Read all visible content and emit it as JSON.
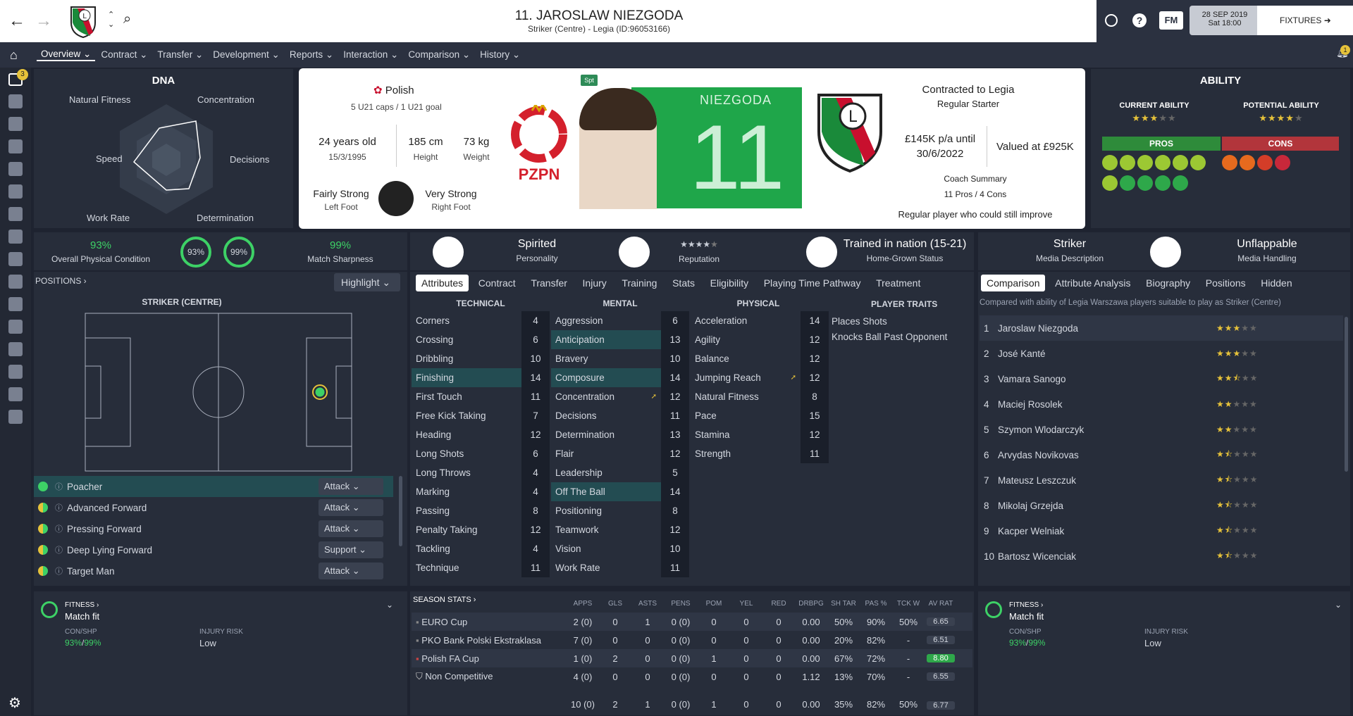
{
  "header": {
    "title": "11. JAROSLAW NIEZGODA",
    "subtitle": "Striker (Centre) - Legia (ID:96053166)",
    "date": "28 SEP 2019",
    "time": "Sat 18:00",
    "fixtures": "FIXTURES",
    "fm": "FM",
    "help": "?",
    "notif_count": "1"
  },
  "nav": {
    "tabs": [
      "Overview",
      "Contract",
      "Transfer",
      "Development",
      "Reports",
      "Interaction",
      "Comparison",
      "History"
    ],
    "inbox_count": "3"
  },
  "dna": {
    "title": "DNA",
    "labels": [
      "Natural Fitness",
      "Concentration",
      "Speed",
      "Decisions",
      "Work Rate",
      "Determination"
    ]
  },
  "profile": {
    "nation": "Polish",
    "caps": "5 U21 caps / 1 U21 goal",
    "age": "24 years old",
    "dob": "15/3/1995",
    "height": "185 cm",
    "height_l": "Height",
    "weight": "73 kg",
    "weight_l": "Weight",
    "left_foot": "Fairly Strong",
    "left_foot_l": "Left Foot",
    "right_foot": "Very Strong",
    "right_foot_l": "Right Foot",
    "spt": "Spt",
    "pzpn": "PZPN",
    "shirt_name": "NIEZGODA",
    "shirt_number": "11",
    "contracted": "Contracted to Legia",
    "status": "Regular Starter",
    "wage": "£145K p/a until",
    "until": "30/6/2022",
    "value": "Valued at £925K",
    "coach_summary": "Coach Summary",
    "pros_cons": "11 Pros / 4 Cons",
    "summary": "Regular player who could still improve"
  },
  "ability": {
    "title": "ABILITY",
    "current": "CURRENT ABILITY",
    "potential": "POTENTIAL ABILITY",
    "current_stars": 3,
    "potential_stars": 4,
    "pros": "PROS",
    "cons": "CONS"
  },
  "condition": {
    "overall": "93%",
    "overall_l": "Overall Physical Condition",
    "ring1": "93%",
    "ring2": "99%",
    "sharp": "99%",
    "sharp_l": "Match Sharpness"
  },
  "positions": {
    "label": "POSITIONS",
    "highlight": "Highlight",
    "pos_title": "STRIKER (CENTRE)",
    "roles": [
      {
        "name": "Poacher",
        "duty": "Attack"
      },
      {
        "name": "Advanced Forward",
        "duty": "Attack"
      },
      {
        "name": "Pressing Forward",
        "duty": "Attack"
      },
      {
        "name": "Deep Lying Forward",
        "duty": "Support"
      },
      {
        "name": "Target Man",
        "duty": "Attack"
      }
    ]
  },
  "personality": {
    "value": "Spirited",
    "label": "Personality",
    "rep_label": "Reputation",
    "trained": "Trained in nation (15-21)",
    "hg": "Home-Grown Status"
  },
  "media": {
    "desc": "Striker",
    "desc_l": "Media Description",
    "handling": "Unflappable",
    "handling_l": "Media Handling"
  },
  "attr_tabs": [
    "Attributes",
    "Contract",
    "Transfer",
    "Injury",
    "Training",
    "Stats",
    "Eligibility",
    "Playing Time Pathway",
    "Treatment"
  ],
  "attrs": {
    "tech_h": "TECHNICAL",
    "mental_h": "MENTAL",
    "phys_h": "PHYSICAL",
    "traits_h": "PLAYER TRAITS",
    "technical": [
      [
        "Corners",
        "4"
      ],
      [
        "Crossing",
        "6"
      ],
      [
        "Dribbling",
        "10"
      ],
      [
        "Finishing",
        "14"
      ],
      [
        "First Touch",
        "11"
      ],
      [
        "Free Kick Taking",
        "7"
      ],
      [
        "Heading",
        "12"
      ],
      [
        "Long Shots",
        "6"
      ],
      [
        "Long Throws",
        "4"
      ],
      [
        "Marking",
        "4"
      ],
      [
        "Passing",
        "8"
      ],
      [
        "Penalty Taking",
        "12"
      ],
      [
        "Tackling",
        "4"
      ],
      [
        "Technique",
        "11"
      ]
    ],
    "mental": [
      [
        "Aggression",
        "6"
      ],
      [
        "Anticipation",
        "13"
      ],
      [
        "Bravery",
        "10"
      ],
      [
        "Composure",
        "14"
      ],
      [
        "Concentration",
        "12"
      ],
      [
        "Decisions",
        "11"
      ],
      [
        "Determination",
        "13"
      ],
      [
        "Flair",
        "12"
      ],
      [
        "Leadership",
        "5"
      ],
      [
        "Off The Ball",
        "14"
      ],
      [
        "Positioning",
        "8"
      ],
      [
        "Teamwork",
        "12"
      ],
      [
        "Vision",
        "10"
      ],
      [
        "Work Rate",
        "11"
      ]
    ],
    "physical": [
      [
        "Acceleration",
        "14"
      ],
      [
        "Agility",
        "12"
      ],
      [
        "Balance",
        "12"
      ],
      [
        "Jumping Reach",
        "12"
      ],
      [
        "Natural Fitness",
        "8"
      ],
      [
        "Pace",
        "15"
      ],
      [
        "Stamina",
        "12"
      ],
      [
        "Strength",
        "11"
      ]
    ],
    "traits": [
      "Places Shots",
      "Knocks Ball Past Opponent"
    ]
  },
  "compare": {
    "tabs": [
      "Comparison",
      "Attribute Analysis",
      "Biography",
      "Positions",
      "Hidden"
    ],
    "note": "Compared with ability of Legia Warszawa players suitable to play as Striker (Centre)",
    "rows": [
      [
        "1",
        "Jaroslaw Niezgoda",
        "3"
      ],
      [
        "2",
        "José Kanté",
        "3"
      ],
      [
        "3",
        "Vamara Sanogo",
        "2.5"
      ],
      [
        "4",
        "Maciej Rosolek",
        "2"
      ],
      [
        "5",
        "Szymon Wlodarczyk",
        "2"
      ],
      [
        "6",
        "Arvydas Novikovas",
        "1.5"
      ],
      [
        "7",
        "Mateusz Leszczuk",
        "1.5"
      ],
      [
        "8",
        "Mikolaj Grzejda",
        "1.5"
      ],
      [
        "9",
        "Kacper Welniak",
        "1.5"
      ],
      [
        "10",
        "Bartosz Wicenciak",
        "1.5"
      ]
    ]
  },
  "fitness": {
    "label": "FITNESS",
    "status": "Match fit",
    "con": "CON/SHP",
    "con_v1": "93%",
    "con_v2": "99%",
    "risk": "INJURY RISK",
    "risk_v": "Low"
  },
  "season": {
    "title": "SEASON STATS",
    "headers": [
      "APPS",
      "GLS",
      "ASTS",
      "PENS",
      "POM",
      "YEL",
      "RED",
      "DRBPG",
      "SH TAR",
      "PAS %",
      "TCK W",
      "AV RAT"
    ],
    "rows": [
      {
        "comp": "EURO Cup",
        "vals": [
          "2 (0)",
          "0",
          "1",
          "0 (0)",
          "0",
          "0",
          "0",
          "0.00",
          "50%",
          "90%",
          "50%",
          "6.65"
        ]
      },
      {
        "comp": "PKO Bank Polski Ekstraklasa",
        "vals": [
          "7 (0)",
          "0",
          "0",
          "0 (0)",
          "0",
          "0",
          "0",
          "0.00",
          "20%",
          "82%",
          "-",
          "6.51"
        ]
      },
      {
        "comp": "Polish FA Cup",
        "vals": [
          "1 (0)",
          "2",
          "0",
          "0 (0)",
          "1",
          "0",
          "0",
          "0.00",
          "67%",
          "72%",
          "-",
          "8.80"
        ]
      },
      {
        "comp": "Non Competitive",
        "vals": [
          "4 (0)",
          "0",
          "0",
          "0 (0)",
          "0",
          "0",
          "0",
          "1.12",
          "13%",
          "70%",
          "-",
          "6.55"
        ]
      }
    ],
    "total": [
      "10 (0)",
      "2",
      "1",
      "0 (0)",
      "1",
      "0",
      "0",
      "0.00",
      "35%",
      "82%",
      "50%",
      "6.77"
    ]
  }
}
